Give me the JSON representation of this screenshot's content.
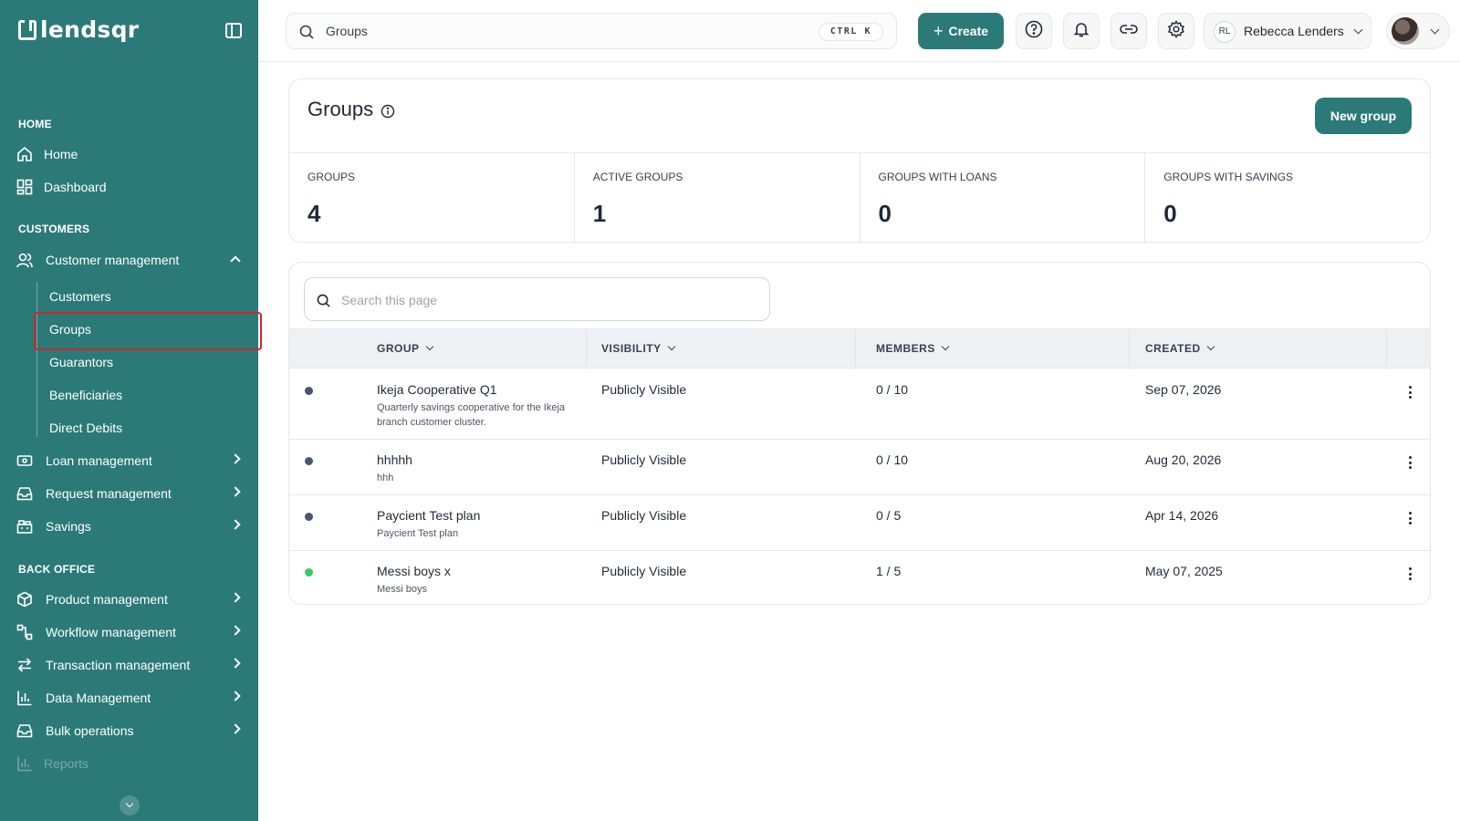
{
  "brand": {
    "name": "lendsqr"
  },
  "sidebar": {
    "sections": [
      {
        "title": "HOME"
      },
      {
        "title": "CUSTOMERS"
      },
      {
        "title": "BACK OFFICE"
      }
    ],
    "home": {
      "label": "Home",
      "icon": "home-icon"
    },
    "dashboard": {
      "label": "Dashboard",
      "icon": "dashboard-icon"
    },
    "customer_management": {
      "label": "Customer management",
      "icon": "users-icon",
      "expanded": true,
      "children": [
        {
          "label": "Customers"
        },
        {
          "label": "Groups",
          "selected": true
        },
        {
          "label": "Guarantors"
        },
        {
          "label": "Beneficiaries"
        },
        {
          "label": "Direct Debits"
        }
      ]
    },
    "items": [
      {
        "label": "Loan management",
        "icon": "loan-icon"
      },
      {
        "label": "Request management",
        "icon": "inbox-icon"
      },
      {
        "label": "Savings",
        "icon": "savings-icon"
      },
      {
        "label": "Product management",
        "icon": "box-icon"
      },
      {
        "label": "Workflow management",
        "icon": "workflow-icon"
      },
      {
        "label": "Transaction management",
        "icon": "transfer-icon"
      },
      {
        "label": "Data Management",
        "icon": "chart-icon"
      },
      {
        "label": "Bulk operations",
        "icon": "inbox-icon"
      },
      {
        "label": "Reports",
        "icon": "chart-icon"
      }
    ]
  },
  "topbar": {
    "search_value": "Groups",
    "shortcut": "CTRL K",
    "create_label": "Create",
    "user": {
      "initials": "RL",
      "name": "Rebecca Lenders"
    }
  },
  "page": {
    "title": "Groups",
    "new_button": "New group",
    "stats": [
      {
        "label": "GROUPS",
        "value": "4"
      },
      {
        "label": "ACTIVE GROUPS",
        "value": "1"
      },
      {
        "label": "GROUPS WITH LOANS",
        "value": "0"
      },
      {
        "label": "GROUPS WITH SAVINGS",
        "value": "0"
      }
    ]
  },
  "table": {
    "search_placeholder": "Search this page",
    "columns": [
      "GROUP",
      "VISIBILITY",
      "MEMBERS",
      "CREATED"
    ],
    "status_colors": {
      "inactive": "#4b5470",
      "active": "#3ec46d"
    },
    "rows": [
      {
        "name": "Ikeja Cooperative Q1",
        "description": "Quarterly savings cooperative for the Ikeja branch customer cluster.",
        "visibility": "Publicly Visible",
        "members": "0 / 10",
        "created": "Sep 07, 2026",
        "status": "inactive"
      },
      {
        "name": "hhhhh",
        "description": "hhh",
        "visibility": "Publicly Visible",
        "members": "0 / 10",
        "created": "Aug 20, 2026",
        "status": "inactive"
      },
      {
        "name": "Paycient Test plan",
        "description": "Paycient Test plan",
        "visibility": "Publicly Visible",
        "members": "0 / 5",
        "created": "Apr 14, 2026",
        "status": "inactive"
      },
      {
        "name": "Messi boys x",
        "description": "Messi boys",
        "visibility": "Publicly Visible",
        "members": "1 / 5",
        "created": "May 07, 2025",
        "status": "active"
      }
    ]
  },
  "colors": {
    "brand": "#2b7a78",
    "selection_outline": "#d0262b"
  }
}
